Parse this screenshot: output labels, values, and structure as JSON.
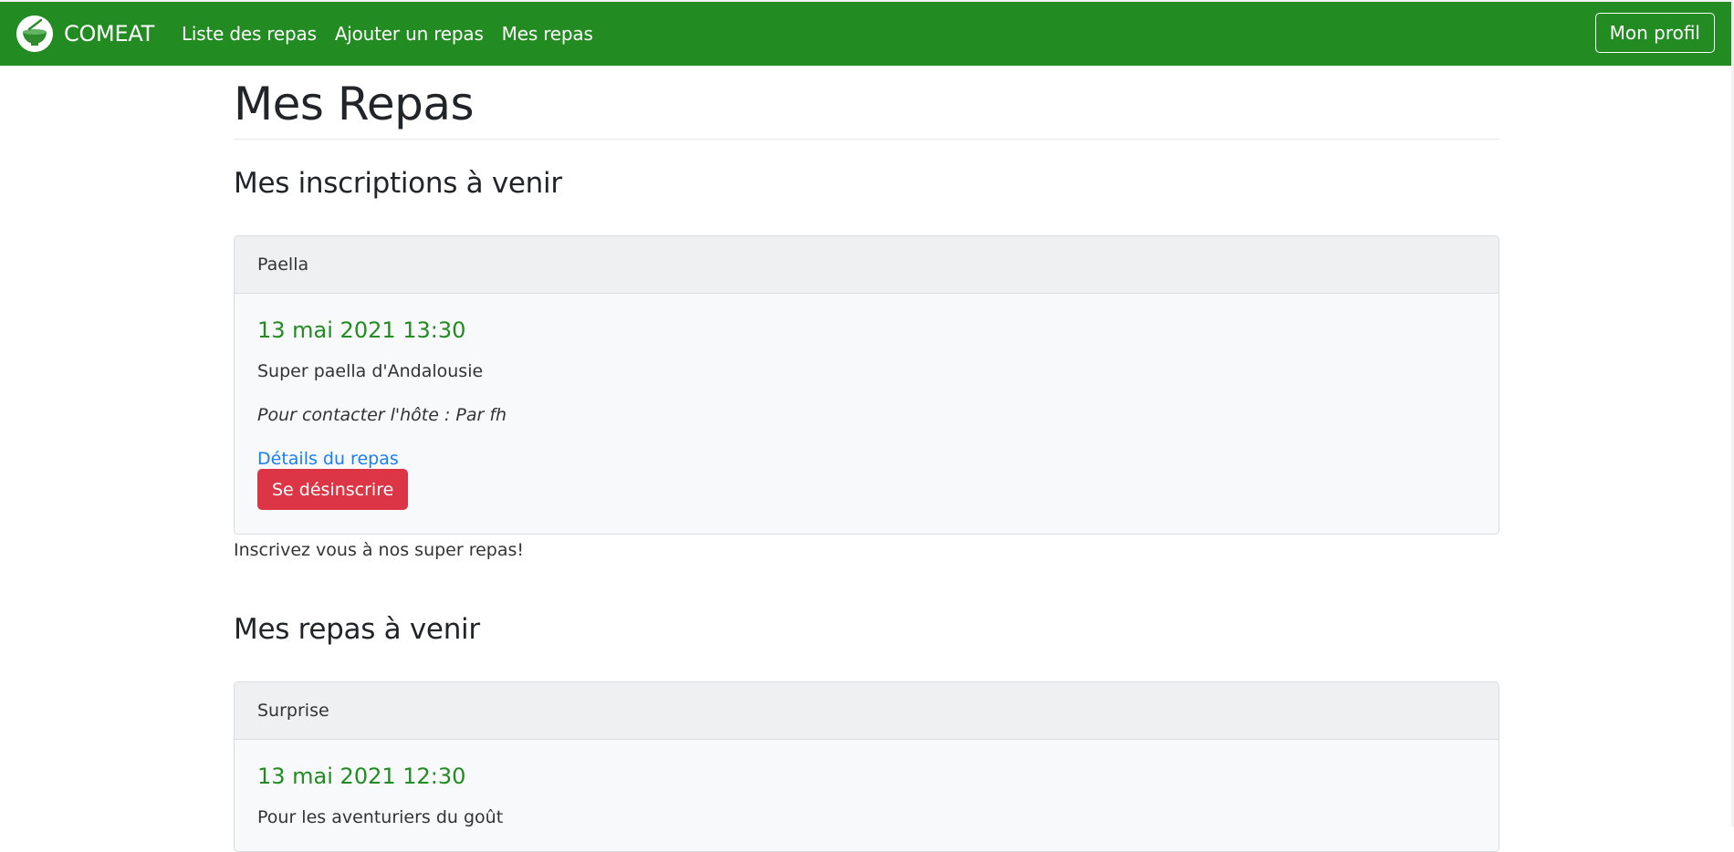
{
  "brand": {
    "name": "COMEAT"
  },
  "nav": {
    "links": [
      "Liste des repas",
      "Ajouter un repas",
      "Mes repas"
    ],
    "profile": "Mon profil"
  },
  "page": {
    "title": "Mes Repas",
    "sections": [
      {
        "title": "Mes inscriptions à venir",
        "card": {
          "header": "Paella",
          "date": "13 mai 2021 13:30",
          "description": "Super paella d'Andalousie",
          "contact": "Pour contacter l'hôte : Par fh",
          "details_link": "Détails du repas",
          "unsubscribe_button": "Se désinscrire"
        },
        "footer_text": "Inscrivez vous à nos super repas!"
      },
      {
        "title": "Mes repas à venir",
        "card": {
          "header": "Surprise",
          "date": "13 mai 2021 12:30",
          "description": "Pour les aventuriers du goût"
        }
      }
    ]
  },
  "colors": {
    "navbar": "#228b22",
    "accent_green": "#228b22",
    "danger": "#dc3545",
    "link": "#1a7ff0"
  },
  "icons": {
    "logo": "bowl-icon"
  }
}
